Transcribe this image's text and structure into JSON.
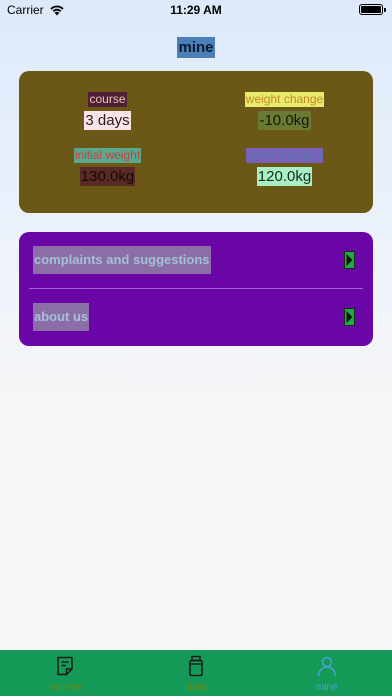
{
  "status_bar": {
    "carrier": "Carrier",
    "time": "11:29 AM"
  },
  "header": {
    "title": "mine"
  },
  "stats": {
    "course": {
      "label": "course",
      "value": "3 days"
    },
    "weight_change": {
      "label": "weight change",
      "value": "-10.0kg"
    },
    "initial_weight": {
      "label": "initial weight",
      "value": "130.0kg"
    },
    "current_weight": {
      "label": "current weight",
      "value": "120.0kg"
    }
  },
  "menu": {
    "items": [
      {
        "label": "complaints and suggestions",
        "icon": "chevron-right-icon"
      },
      {
        "label": "about us",
        "icon": "chevron-right-icon"
      }
    ]
  },
  "tab_bar": {
    "tabs": [
      {
        "label": "records",
        "icon": "note-icon"
      },
      {
        "label": "data",
        "icon": "battery-jar-icon"
      },
      {
        "label": "mine",
        "icon": "person-icon",
        "selected": true
      }
    ]
  },
  "colors": {
    "stats_card_bg": "#6b5716",
    "menu_card_bg": "#6a06a6",
    "tab_bar_bg": "#149a56",
    "selected_tab": "#4aa0d8"
  }
}
